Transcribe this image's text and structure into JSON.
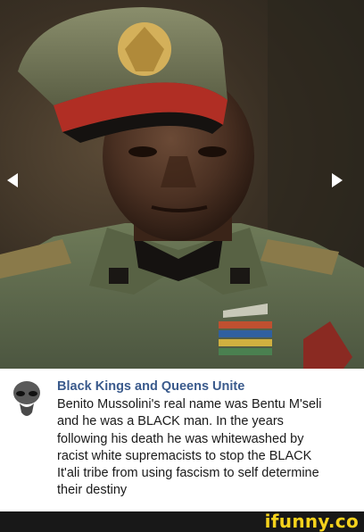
{
  "photo": {
    "prev_label": "◀",
    "next_label": "▶"
  },
  "post": {
    "author": "Black Kings and Queens Unite",
    "body_lines": [
      "Benito Mussolini's real name was Bentu M'seli",
      "and he was a BLACK man. In the years",
      "following his death he was whitewashed by",
      "racist white supremacists to stop the BLACK",
      "It'ali tribe from using fascism to self determine",
      "their destiny"
    ]
  },
  "footer": {
    "brand": "ifunny.co",
    "brand_color": "#f6d21c"
  }
}
